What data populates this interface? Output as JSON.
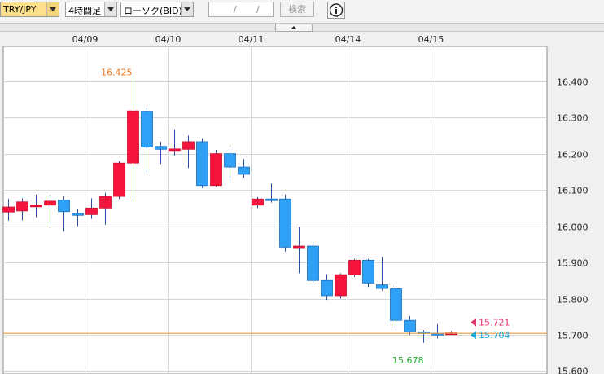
{
  "toolbar": {
    "pair": "TRY/JPY",
    "timeframe": "4時間足",
    "chart_type": "ローソク(BID)",
    "date_sep": "/",
    "search_label": "検索"
  },
  "chart_data": {
    "type": "candlestick",
    "x_labels": [
      {
        "label": "04/09",
        "candle": 5.5
      },
      {
        "label": "04/10",
        "candle": 11.5
      },
      {
        "label": "04/11",
        "candle": 17.5
      },
      {
        "label": "04/14",
        "candle": 24.5
      },
      {
        "label": "04/15",
        "candle": 30.5
      }
    ],
    "y_ticks": [
      "16.400",
      "16.300",
      "16.200",
      "16.100",
      "16.000",
      "15.900",
      "15.800",
      "15.700",
      "15.600"
    ],
    "ylim": [
      15.592,
      16.496
    ],
    "candles": [
      {
        "o": 16.039,
        "c": 16.053,
        "h": 16.075,
        "l": 16.015
      },
      {
        "o": 16.042,
        "c": 16.067,
        "h": 16.077,
        "l": 16.016
      },
      {
        "o": 16.058,
        "c": 16.058,
        "h": 16.087,
        "l": 16.025
      },
      {
        "o": 16.058,
        "c": 16.069,
        "h": 16.086,
        "l": 16.005
      },
      {
        "o": 16.072,
        "c": 16.04,
        "h": 16.083,
        "l": 15.985
      },
      {
        "o": 16.035,
        "c": 16.03,
        "h": 16.048,
        "l": 16.0
      },
      {
        "o": 16.032,
        "c": 16.05,
        "h": 16.077,
        "l": 16.02
      },
      {
        "o": 16.05,
        "c": 16.082,
        "h": 16.092,
        "l": 16.004
      },
      {
        "o": 16.082,
        "c": 16.174,
        "h": 16.18,
        "l": 16.075
      },
      {
        "o": 16.174,
        "c": 16.318,
        "h": 16.425,
        "l": 16.07
      },
      {
        "o": 16.317,
        "c": 16.218,
        "h": 16.325,
        "l": 16.15
      },
      {
        "o": 16.22,
        "c": 16.212,
        "h": 16.233,
        "l": 16.172
      },
      {
        "o": 16.213,
        "c": 16.213,
        "h": 16.267,
        "l": 16.195
      },
      {
        "o": 16.212,
        "c": 16.233,
        "h": 16.25,
        "l": 16.16
      },
      {
        "o": 16.233,
        "c": 16.112,
        "h": 16.243,
        "l": 16.105
      },
      {
        "o": 16.112,
        "c": 16.2,
        "h": 16.21,
        "l": 16.108
      },
      {
        "o": 16.2,
        "c": 16.163,
        "h": 16.213,
        "l": 16.125
      },
      {
        "o": 16.163,
        "c": 16.143,
        "h": 16.185,
        "l": 16.133
      },
      {
        "o": 16.058,
        "c": 16.075,
        "h": 16.08,
        "l": 16.05
      },
      {
        "o": 16.075,
        "c": 16.073,
        "h": 16.118,
        "l": 16.065
      },
      {
        "o": 16.075,
        "c": 15.942,
        "h": 16.087,
        "l": 15.93
      },
      {
        "o": 15.942,
        "c": 15.945,
        "h": 15.998,
        "l": 15.87
      },
      {
        "o": 15.945,
        "c": 15.85,
        "h": 15.957,
        "l": 15.843
      },
      {
        "o": 15.85,
        "c": 15.808,
        "h": 15.867,
        "l": 15.796
      },
      {
        "o": 15.808,
        "c": 15.866,
        "h": 15.87,
        "l": 15.8
      },
      {
        "o": 15.866,
        "c": 15.906,
        "h": 15.91,
        "l": 15.86
      },
      {
        "o": 15.906,
        "c": 15.843,
        "h": 15.91,
        "l": 15.832
      },
      {
        "o": 15.838,
        "c": 15.828,
        "h": 15.915,
        "l": 15.822
      },
      {
        "o": 15.827,
        "c": 15.74,
        "h": 15.835,
        "l": 15.72
      },
      {
        "o": 15.74,
        "c": 15.708,
        "h": 15.752,
        "l": 15.7
      },
      {
        "o": 15.708,
        "c": 15.706,
        "h": 15.713,
        "l": 15.678
      },
      {
        "o": 15.704,
        "c": 15.7,
        "h": 15.73,
        "l": 15.69
      },
      {
        "o": 15.705,
        "c": 15.705,
        "h": 15.71,
        "l": 15.7
      }
    ],
    "high_label": "16.425",
    "low_label": "15.678",
    "high_candle": 9,
    "low_candle": 30,
    "ask_label": "15.721",
    "bid_label": "15.704",
    "ask_value": 15.721,
    "bid_value": 15.704,
    "colors": {
      "up": "#f5143c",
      "down": "#2ea0f5",
      "current_line": "#e89a3c",
      "high": "#f07820",
      "low": "#1fad2c",
      "ask": "#e8336a",
      "bid": "#22a8d8"
    }
  }
}
